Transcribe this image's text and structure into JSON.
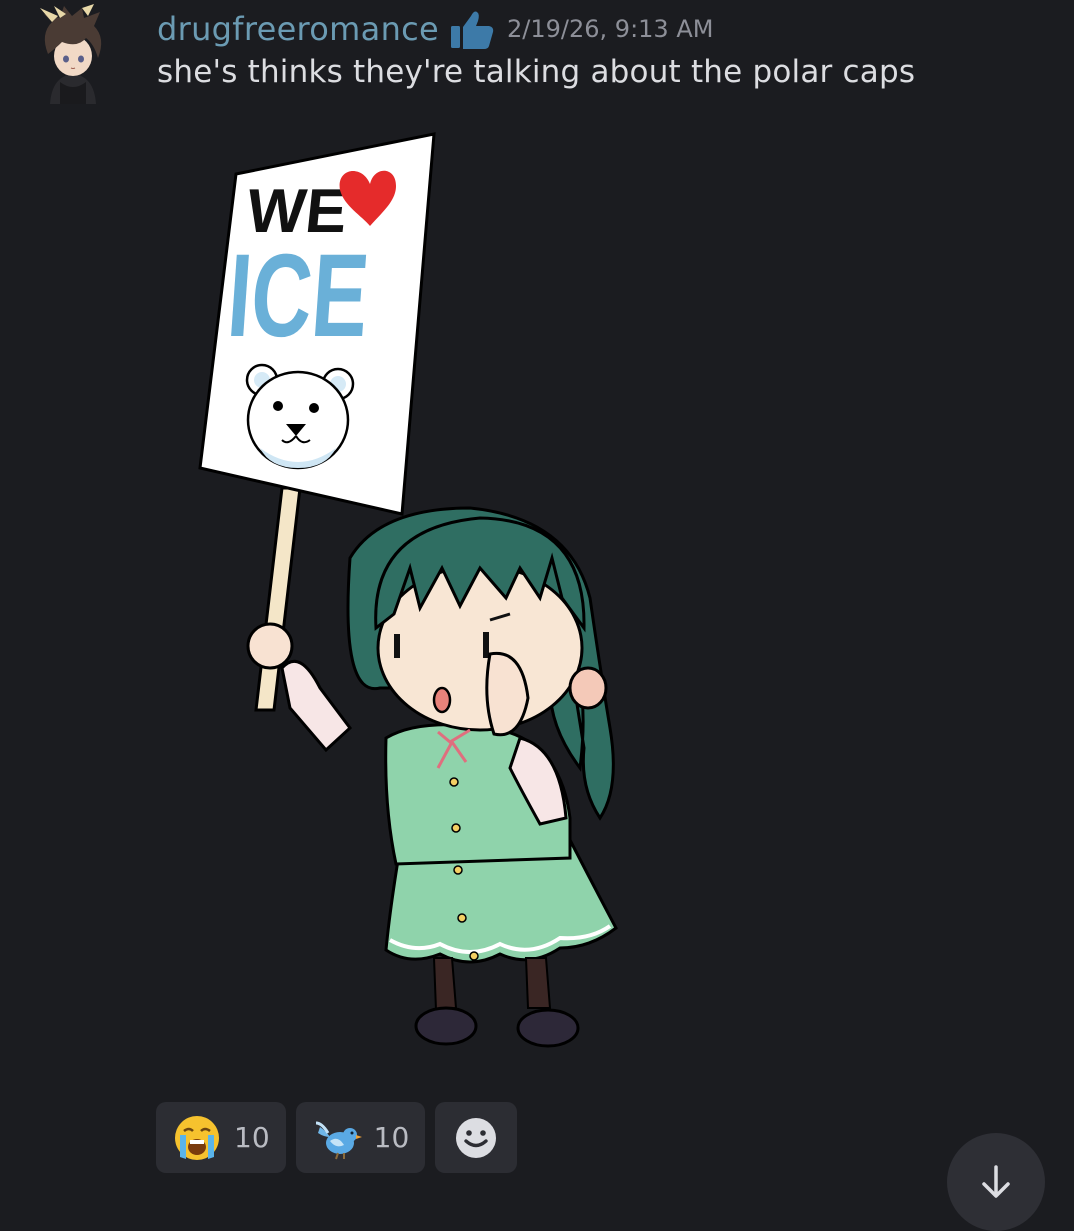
{
  "message": {
    "author": "drugfreeromance",
    "role_icon": "thumbs-up-icon",
    "timestamp": "2/19/26, 9:13 AM",
    "text": "she's thinks they're talking about the polar caps",
    "sticker": {
      "sign_line1": "WE",
      "sign_line2": "ICE",
      "heart_color": "#e52b2b",
      "ice_color": "#6ab0d8"
    }
  },
  "reactions": [
    {
      "emoji": "loudly-crying-face-icon",
      "count": "10"
    },
    {
      "emoji": "blue-bird-icon",
      "count": "10"
    }
  ],
  "add_reaction_icon": "smiley-face-icon",
  "scroll_button_icon": "arrow-down-icon",
  "colors": {
    "background": "#1b1c20",
    "username": "#6b9bb3",
    "role_icon": "#3d7aa8",
    "reaction_bg": "#2c2d33"
  }
}
